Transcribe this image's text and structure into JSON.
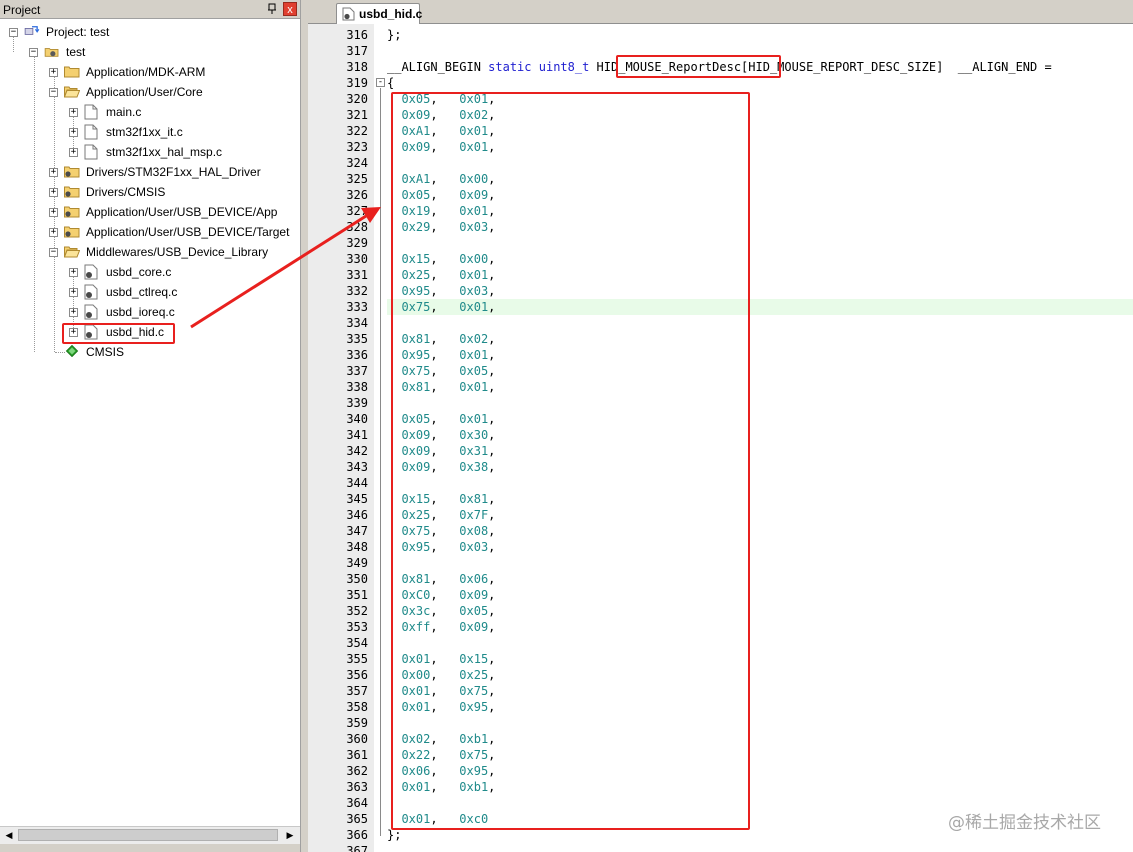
{
  "panel": {
    "title": "Project",
    "pin_symbol": "ᵖ",
    "close_symbol": "x"
  },
  "tree": {
    "project": "Project: test",
    "target": "test",
    "groups": [
      "Application/MDK-ARM",
      "Application/User/Core",
      "Drivers/STM32F1xx_HAL_Driver",
      "Drivers/CMSIS",
      "Application/User/USB_DEVICE/App",
      "Application/User/USB_DEVICE/Target",
      "Middlewares/USB_Device_Library"
    ],
    "core_files": [
      "main.c",
      "stm32f1xx_it.c",
      "stm32f1xx_hal_msp.c"
    ],
    "usb_files": [
      "usbd_core.c",
      "usbd_ctlreq.c",
      "usbd_ioreq.c",
      "usbd_hid.c"
    ],
    "cmsis": "CMSIS"
  },
  "editor": {
    "tab_label": "usbd_hid.c",
    "lines": [
      {
        "n": "316",
        "text": "};"
      },
      {
        "n": "317",
        "text": ""
      },
      {
        "n": "318",
        "text": "__ALIGN_BEGIN static uint8_t HID_MOUSE_ReportDesc[HID_MOUSE_REPORT_DESC_SIZE]  __ALIGN_END ="
      },
      {
        "n": "319",
        "text": "{"
      },
      {
        "n": "320",
        "text": "  0x05,   0x01,"
      },
      {
        "n": "321",
        "text": "  0x09,   0x02,"
      },
      {
        "n": "322",
        "text": "  0xA1,   0x01,"
      },
      {
        "n": "323",
        "text": "  0x09,   0x01,"
      },
      {
        "n": "324",
        "text": ""
      },
      {
        "n": "325",
        "text": "  0xA1,   0x00,"
      },
      {
        "n": "326",
        "text": "  0x05,   0x09,"
      },
      {
        "n": "327",
        "text": "  0x19,   0x01,"
      },
      {
        "n": "328",
        "text": "  0x29,   0x03,"
      },
      {
        "n": "329",
        "text": ""
      },
      {
        "n": "330",
        "text": "  0x15,   0x00,"
      },
      {
        "n": "331",
        "text": "  0x25,   0x01,"
      },
      {
        "n": "332",
        "text": "  0x95,   0x03,"
      },
      {
        "n": "333",
        "text": "  0x75,   0x01,"
      },
      {
        "n": "334",
        "text": ""
      },
      {
        "n": "335",
        "text": "  0x81,   0x02,"
      },
      {
        "n": "336",
        "text": "  0x95,   0x01,"
      },
      {
        "n": "337",
        "text": "  0x75,   0x05,"
      },
      {
        "n": "338",
        "text": "  0x81,   0x01,"
      },
      {
        "n": "339",
        "text": ""
      },
      {
        "n": "340",
        "text": "  0x05,   0x01,"
      },
      {
        "n": "341",
        "text": "  0x09,   0x30,"
      },
      {
        "n": "342",
        "text": "  0x09,   0x31,"
      },
      {
        "n": "343",
        "text": "  0x09,   0x38,"
      },
      {
        "n": "344",
        "text": ""
      },
      {
        "n": "345",
        "text": "  0x15,   0x81,"
      },
      {
        "n": "346",
        "text": "  0x25,   0x7F,"
      },
      {
        "n": "347",
        "text": "  0x75,   0x08,"
      },
      {
        "n": "348",
        "text": "  0x95,   0x03,"
      },
      {
        "n": "349",
        "text": ""
      },
      {
        "n": "350",
        "text": "  0x81,   0x06,"
      },
      {
        "n": "351",
        "text": "  0xC0,   0x09,"
      },
      {
        "n": "352",
        "text": "  0x3c,   0x05,"
      },
      {
        "n": "353",
        "text": "  0xff,   0x09,"
      },
      {
        "n": "354",
        "text": ""
      },
      {
        "n": "355",
        "text": "  0x01,   0x15,"
      },
      {
        "n": "356",
        "text": "  0x00,   0x25,"
      },
      {
        "n": "357",
        "text": "  0x01,   0x75,"
      },
      {
        "n": "358",
        "text": "  0x01,   0x95,"
      },
      {
        "n": "359",
        "text": ""
      },
      {
        "n": "360",
        "text": "  0x02,   0xb1,"
      },
      {
        "n": "361",
        "text": "  0x22,   0x75,"
      },
      {
        "n": "362",
        "text": "  0x06,   0x95,"
      },
      {
        "n": "363",
        "text": "  0x01,   0xb1,"
      },
      {
        "n": "364",
        "text": ""
      },
      {
        "n": "365",
        "text": "  0x01,   0xc0"
      },
      {
        "n": "366",
        "text": "};"
      },
      {
        "n": "367",
        "text": ""
      }
    ],
    "highlighted_line": "333",
    "fold_symbol": "-"
  },
  "watermark": "@稀土掘金技术社区",
  "colors": {
    "annotation_red": "#e8201e",
    "hex_literal": "#1f8a8a",
    "keyword": "#1f1fd0",
    "current_line": "#e8fbe8"
  }
}
